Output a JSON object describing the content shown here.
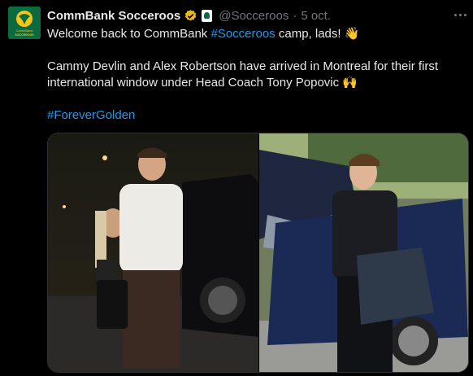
{
  "tweet": {
    "author_name": "CommBank Socceroos",
    "handle": "@Socceroos",
    "separator": "·",
    "date": "5 oct.",
    "lines": {
      "line1_prefix": "Welcome back to CommBank ",
      "line1_hashtag": "#Socceroos",
      "line1_suffix": " camp, lads! 👋",
      "line2": "Cammy Devlin and Alex Robertson have arrived in Montreal for their first international window under Head Coach Tony Popovic 🙌",
      "hashtag": "#ForeverGolden"
    },
    "avatar_text": {
      "bank": "CommBank",
      "team": "SOCCEROOS"
    }
  },
  "icons": [
    "verified-badge-icon",
    "affiliate-badge-icon",
    "more-options-icon"
  ],
  "colors": {
    "background": "#000000",
    "text": "#e7e9ea",
    "muted": "#71767b",
    "link": "#1d9bf0",
    "verified": "#e8b923",
    "avatar_bg": "#0b6b3f"
  }
}
